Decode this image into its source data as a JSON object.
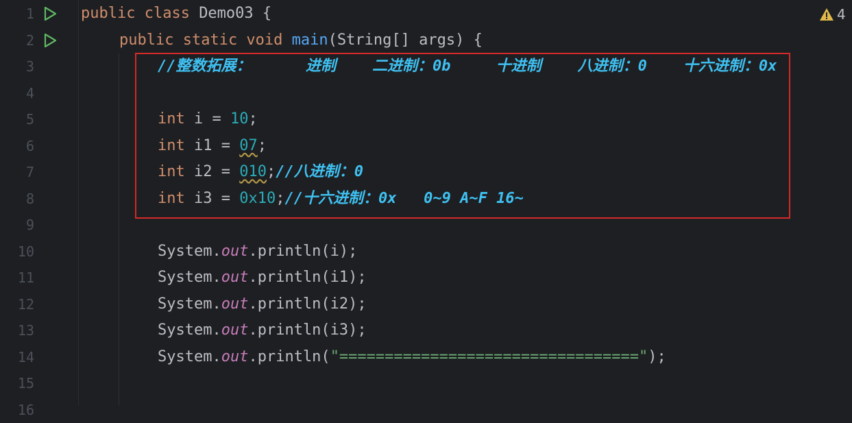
{
  "editor": {
    "warnings_count": "4",
    "lines": [
      {
        "n": "1",
        "tokens": [
          [
            "kw",
            "public class "
          ],
          [
            "plain",
            "Demo03 {"
          ]
        ],
        "indent": 0,
        "run": true
      },
      {
        "n": "2",
        "tokens": [
          [
            "kw",
            "public static void "
          ],
          [
            "fn",
            "main"
          ],
          [
            "plain",
            "(String[] args) {"
          ]
        ],
        "indent": 1,
        "run": true
      },
      {
        "n": "3",
        "tokens": [
          [
            "cmt",
            "//整数拓展：      进制    二进制：0b     十进制    八进制：0    十六进制：0x"
          ]
        ],
        "indent": 2
      },
      {
        "n": "4",
        "tokens": [],
        "indent": 2
      },
      {
        "n": "5",
        "tokens": [
          [
            "kw",
            "int "
          ],
          [
            "plain",
            "i = "
          ],
          [
            "num",
            "10"
          ],
          [
            "plain",
            ";"
          ]
        ],
        "indent": 2
      },
      {
        "n": "6",
        "tokens": [
          [
            "kw",
            "int "
          ],
          [
            "plain",
            "i1 = "
          ],
          [
            "numw",
            "07"
          ],
          [
            "plain",
            ";"
          ]
        ],
        "indent": 2
      },
      {
        "n": "7",
        "tokens": [
          [
            "kw",
            "int "
          ],
          [
            "plain",
            "i2 = "
          ],
          [
            "numw",
            "010"
          ],
          [
            "plain",
            ";"
          ],
          [
            "cmt",
            "//八进制：0"
          ]
        ],
        "indent": 2
      },
      {
        "n": "8",
        "tokens": [
          [
            "kw",
            "int "
          ],
          [
            "plain",
            "i3 = "
          ],
          [
            "num",
            "0x10"
          ],
          [
            "plain",
            ";"
          ],
          [
            "cmt",
            "//十六进制：0x   0~9 A~F 16~"
          ]
        ],
        "indent": 2
      },
      {
        "n": "9",
        "tokens": [],
        "indent": 2
      },
      {
        "n": "10",
        "tokens": [
          [
            "plain",
            "System."
          ],
          [
            "field",
            "out"
          ],
          [
            "plain",
            ".println(i);"
          ]
        ],
        "indent": 2
      },
      {
        "n": "11",
        "tokens": [
          [
            "plain",
            "System."
          ],
          [
            "field",
            "out"
          ],
          [
            "plain",
            ".println(i1);"
          ]
        ],
        "indent": 2
      },
      {
        "n": "12",
        "tokens": [
          [
            "plain",
            "System."
          ],
          [
            "field",
            "out"
          ],
          [
            "plain",
            ".println(i2);"
          ]
        ],
        "indent": 2
      },
      {
        "n": "13",
        "tokens": [
          [
            "plain",
            "System."
          ],
          [
            "field",
            "out"
          ],
          [
            "plain",
            ".println(i3);"
          ]
        ],
        "indent": 2
      },
      {
        "n": "14",
        "tokens": [
          [
            "plain",
            "System."
          ],
          [
            "field",
            "out"
          ],
          [
            "plain",
            ".println("
          ],
          [
            "str",
            "\"=================================\""
          ],
          [
            "plain",
            ");"
          ]
        ],
        "indent": 2
      },
      {
        "n": "15",
        "tokens": [],
        "indent": 2
      },
      {
        "n": "16",
        "tokens": [],
        "indent": 2
      }
    ]
  },
  "colors": {
    "background": "#1e1f22",
    "keyword": "#cf8e6d",
    "method": "#56a8f5",
    "number": "#2aacb8",
    "string": "#6aab73",
    "field": "#c77dbb",
    "comment": "#3fc1f2",
    "highlight_box": "#d42a2a",
    "run_icon": "#5fb865",
    "warning": "#e0b94a"
  }
}
